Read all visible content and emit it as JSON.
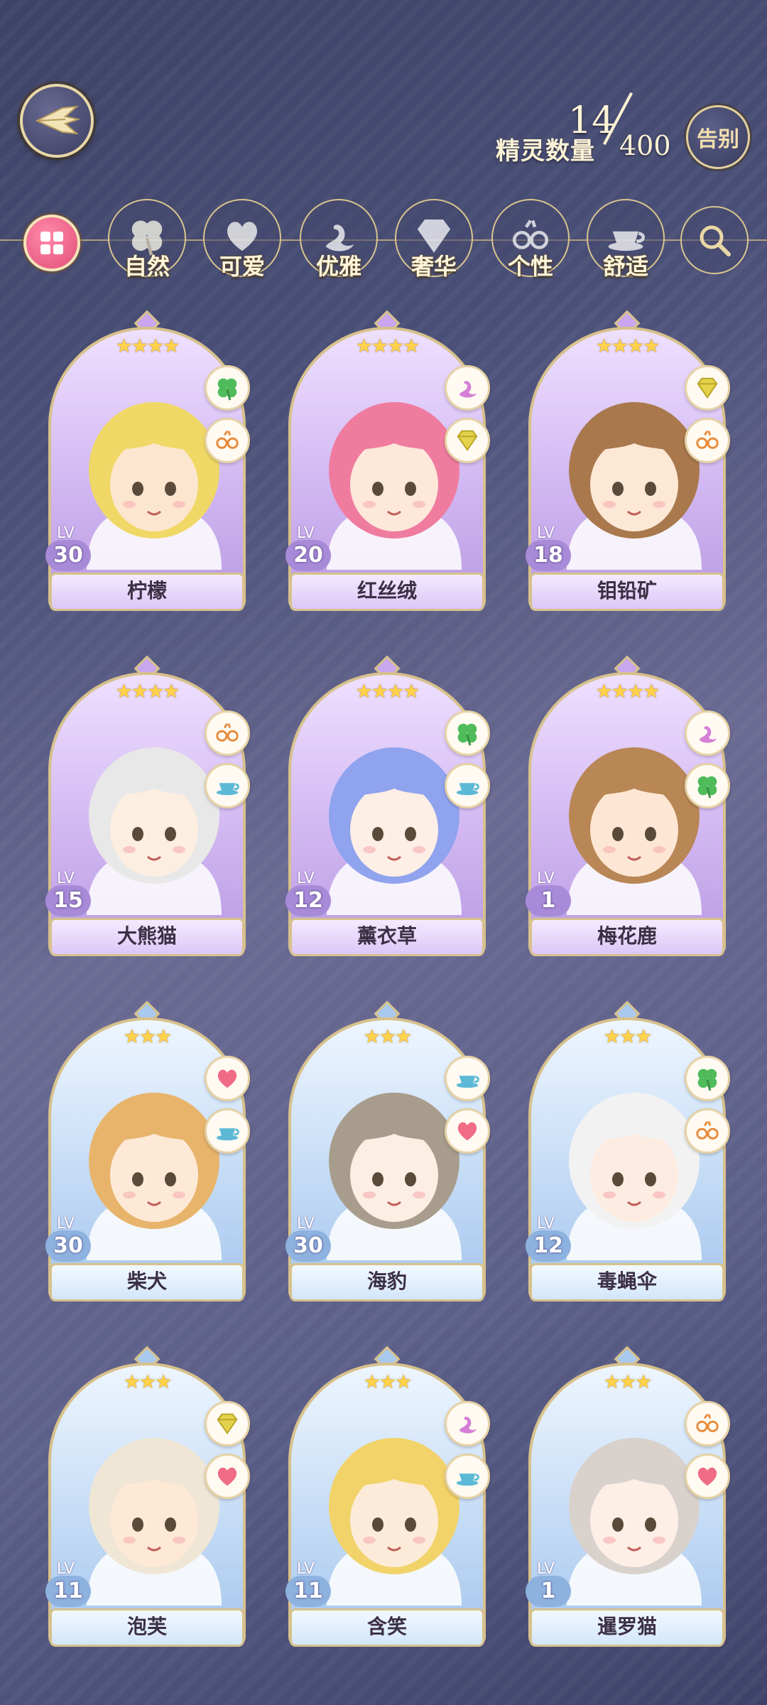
{
  "header": {
    "count_label": "精灵数量",
    "count_current": "14",
    "count_total": "400",
    "farewell_label": "告别"
  },
  "filters": [
    {
      "label": "自然",
      "icon": "clover-icon"
    },
    {
      "label": "可爱",
      "icon": "heart-icon"
    },
    {
      "label": "优雅",
      "icon": "swan-icon"
    },
    {
      "label": "奢华",
      "icon": "diamond-icon"
    },
    {
      "label": "个性",
      "icon": "glasses-icon"
    },
    {
      "label": "舒适",
      "icon": "teacup-icon"
    }
  ],
  "cards": [
    {
      "name": "柠檬",
      "level": "30",
      "stars": "★★★★",
      "rarity": 4,
      "traits": [
        "clover",
        "glasses"
      ],
      "hair": "#f0d866",
      "skin": "#fde6cf"
    },
    {
      "name": "红丝绒",
      "level": "20",
      "stars": "★★★★",
      "rarity": 4,
      "traits": [
        "swan",
        "diamond"
      ],
      "hair": "#ef7c9f",
      "skin": "#fde8d9"
    },
    {
      "name": "钼铅矿",
      "level": "18",
      "stars": "★★★★",
      "rarity": 4,
      "traits": [
        "diamond",
        "glasses"
      ],
      "hair": "#a9784d",
      "skin": "#fde8d6"
    },
    {
      "name": "大熊猫",
      "level": "15",
      "stars": "★★★★",
      "rarity": 4,
      "traits": [
        "glasses",
        "teacup"
      ],
      "hair": "#e8e8e8",
      "skin": "#fdeee2"
    },
    {
      "name": "薰衣草",
      "level": "12",
      "stars": "★★★★",
      "rarity": 4,
      "traits": [
        "clover",
        "teacup"
      ],
      "hair": "#8fa3ee",
      "skin": "#fdeee6"
    },
    {
      "name": "梅花鹿",
      "level": "1",
      "stars": "★★★★",
      "rarity": 4,
      "traits": [
        "swan",
        "clover"
      ],
      "hair": "#b98656",
      "skin": "#fde7d4"
    },
    {
      "name": "柴犬",
      "level": "30",
      "stars": "★★★",
      "rarity": 3,
      "traits": [
        "heart",
        "teacup"
      ],
      "hair": "#e8b46c",
      "skin": "#fde9d6"
    },
    {
      "name": "海豹",
      "level": "30",
      "stars": "★★★",
      "rarity": 3,
      "traits": [
        "teacup",
        "heart"
      ],
      "hair": "#a89d8c",
      "skin": "#fdeee4"
    },
    {
      "name": "毒蝇伞",
      "level": "12",
      "stars": "★★★",
      "rarity": 3,
      "traits": [
        "clover",
        "glasses"
      ],
      "hair": "#f2f2f2",
      "skin": "#fdece1"
    },
    {
      "name": "泡芙",
      "level": "11",
      "stars": "★★★",
      "rarity": 3,
      "traits": [
        "diamond",
        "heart"
      ],
      "hair": "#efe6d6",
      "skin": "#fde9d6"
    },
    {
      "name": "含笑",
      "level": "11",
      "stars": "★★★",
      "rarity": 3,
      "traits": [
        "swan",
        "teacup"
      ],
      "hair": "#f2d36a",
      "skin": "#fdebd9"
    },
    {
      "name": "暹罗猫",
      "level": "1",
      "stars": "★★★",
      "rarity": 3,
      "traits": [
        "glasses",
        "heart"
      ],
      "hair": "#d9d2cc",
      "skin": "#fdeee6"
    }
  ],
  "level_tag": "LV"
}
